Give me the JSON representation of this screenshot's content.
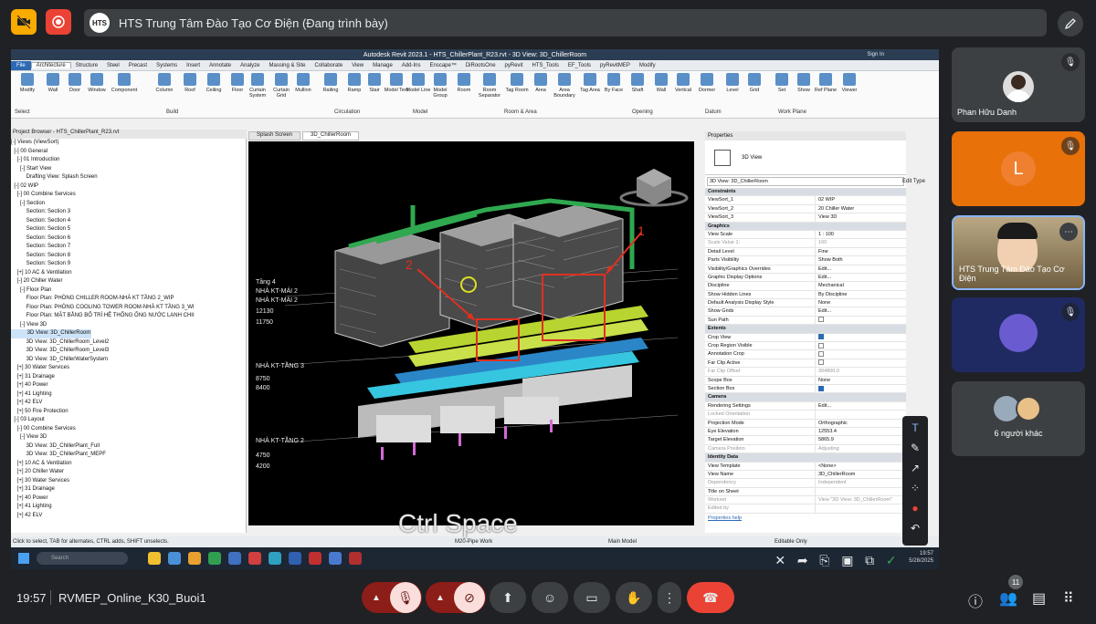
{
  "meet": {
    "presenter_title": "HTS Trung Tâm Đào Tạo Cơ Điện (Đang trình bày)",
    "presenter_logo": "HTS",
    "time": "19:57",
    "meeting_code": "RVMEP_Online_K30_Buoi1",
    "participant_count_badge": "11",
    "colors": {
      "bg": "#202124",
      "end_call": "#ea4335",
      "accent_yellow": "#f9ab00"
    }
  },
  "participants": [
    {
      "name": "Phan Hữu Danh",
      "muted": true,
      "bg": "#3c4043"
    },
    {
      "name": "L",
      "muted": true,
      "bg": "#e8710a"
    },
    {
      "name": "HTS Trung Tâm Đào Tạo Cơ Điện",
      "muted": false,
      "bg": "#8a7a5a"
    },
    {
      "name": "",
      "muted": true,
      "bg": "#1f2a63"
    },
    {
      "name": "6 người khác",
      "muted": false,
      "bg": "#3c4043"
    }
  ],
  "revit": {
    "window_title": "Autodesk Revit 2023.1 - HTS_ChillerPlant_R23.rvt - 3D View: 3D_ChillerRoom",
    "sign_in": "Sign In",
    "tabs": [
      "File",
      "Architecture",
      "Structure",
      "Steel",
      "Precast",
      "Systems",
      "Insert",
      "Annotate",
      "Analyze",
      "Massing & Site",
      "Collaborate",
      "View",
      "Manage",
      "Add-Ins",
      "Enscape™",
      "DiRootsOne",
      "pyRevit",
      "HTS_Tools",
      "EF_Tools",
      "pyRevitMEP",
      "Modify"
    ],
    "ribbon_buttons": [
      "Modify",
      "Wall",
      "Door",
      "Window",
      "Component",
      "Column",
      "Roof",
      "Ceiling",
      "Floor",
      "Curtain System",
      "Curtain Grid",
      "Mullion",
      "Railing",
      "Ramp",
      "Stair",
      "Model Text",
      "Model Line",
      "Model Group",
      "Room",
      "Room Separator",
      "Tag Room",
      "Area",
      "Area Boundary",
      "Tag Area",
      "By Face",
      "Shaft",
      "Wall",
      "Vertical",
      "Dormer",
      "Level",
      "Grid",
      "Set",
      "Show",
      "Ref Plane",
      "Viewer"
    ],
    "ribbon_groups": [
      "Select",
      "Build",
      "Circulation",
      "Model",
      "Room & Area",
      "Opening",
      "Datum",
      "Work Plane"
    ],
    "project_browser_title": "Project Browser - HTS_ChillerPlant_R23.rvt",
    "project_browser": [
      "[-] Views (ViewSort)",
      "  [-] 00 General",
      "    [-] 01 Introduction",
      "      [-] Start View",
      "          Drafting View: Splash Screen",
      "  [-] 02 WIP",
      "    [-] 00 Combine Services",
      "      [-] Section",
      "          Section: Section 3",
      "          Section: Section 4",
      "          Section: Section 5",
      "          Section: Section 6",
      "          Section: Section 7",
      "          Section: Section 8",
      "          Section: Section 9",
      "    [+] 10 AC & Ventilation",
      "    [-] 20 Chiller Water",
      "      [-] Floor Plan",
      "          Floor Plan: PHÒNG CHILLER ROOM-NHÀ KT TẦNG 2_WIP",
      "          Floor Plan: PHÒNG COOLING TOWER ROOM-NHÀ KT TẦNG 3_WI",
      "          Floor Plan: MẶT BẰNG BỐ TRÍ HỆ THỐNG ỐNG NƯỚC LẠNH CHII",
      "      [-] View 3D",
      "          3D View: 3D_ChillerRoom",
      "          3D View: 3D_ChillerRoom_Level2",
      "          3D View: 3D_ChillerRoom_Level3",
      "          3D View: 3D_ChillerWaterSystem",
      "    [+] 30 Water Services",
      "    [+] 31 Drainage",
      "    [+] 40 Power",
      "    [+] 41 Lighting",
      "    [+] 42 ELV",
      "    [+] 50 Fire Protection",
      "  [-] 03 Layout",
      "    [-] 00 Combine Services",
      "      [-] View 3D",
      "          3D View: 3D_ChillerPlant_Full",
      "          3D View: 3D_ChillerPlant_MEPF",
      "    [+] 10 AC & Ventilation",
      "    [+] 20 Chiller Water",
      "    [+] 30 Water Services",
      "    [+] 31 Drainage",
      "    [+] 40 Power",
      "    [+] 41 Lighting",
      "    [+] 42 ELV"
    ],
    "selected_view": "3D View: 3D_ChillerRoom",
    "view_tabs": [
      "Splash Screen",
      "3D_ChillerRoom"
    ],
    "levels": [
      "Tầng 4",
      "NHÀ KT-MÁI 2",
      "NHÀ KT-MÁI 2",
      "12130",
      "11750",
      "NHÀ KT-TẦNG 3",
      "8750",
      "8400",
      "NHÀ KT-TẦNG 2",
      "4750",
      "4200"
    ],
    "markers": [
      "1",
      "2"
    ],
    "properties": {
      "title": "Properties",
      "type_name": "3D View",
      "selector": "3D View: 3D_ChillerRoom",
      "edit_type": "Edit Type",
      "rows": [
        {
          "k": "Constraints",
          "section": true
        },
        {
          "k": "ViewSort_1",
          "v": "02 WIP"
        },
        {
          "k": "ViewSort_2",
          "v": "20 Chiller Water"
        },
        {
          "k": "ViewSort_3",
          "v": "View 3D"
        },
        {
          "k": "Graphics",
          "section": true
        },
        {
          "k": "View Scale",
          "v": "1 : 100"
        },
        {
          "k": "Scale Value    1:",
          "v": "100",
          "dim": true
        },
        {
          "k": "Detail Level",
          "v": "Fine"
        },
        {
          "k": "Parts Visibility",
          "v": "Show Both"
        },
        {
          "k": "Visibility/Graphics Overrides",
          "v": "Edit..."
        },
        {
          "k": "Graphic Display Options",
          "v": "Edit..."
        },
        {
          "k": "Discipline",
          "v": "Mechanical"
        },
        {
          "k": "Show Hidden Lines",
          "v": "By Discipline"
        },
        {
          "k": "Default Analysis Display Style",
          "v": "None"
        },
        {
          "k": "Show Grids",
          "v": "Edit..."
        },
        {
          "k": "Sun Path",
          "v": "",
          "check": "off"
        },
        {
          "k": "Extents",
          "section": true
        },
        {
          "k": "Crop View",
          "v": "",
          "check": "on"
        },
        {
          "k": "Crop Region Visible",
          "v": "",
          "check": "off"
        },
        {
          "k": "Annotation Crop",
          "v": "",
          "check": "off"
        },
        {
          "k": "Far Clip Active",
          "v": "",
          "check": "off"
        },
        {
          "k": "Far Clip Offset",
          "v": "304800.0",
          "dim": true
        },
        {
          "k": "Scope Box",
          "v": "None"
        },
        {
          "k": "Section Box",
          "v": "",
          "check": "on"
        },
        {
          "k": "Camera",
          "section": true
        },
        {
          "k": "Rendering Settings",
          "v": "Edit..."
        },
        {
          "k": "Locked Orientation",
          "v": "",
          "dim": true
        },
        {
          "k": "Projection Mode",
          "v": "Orthographic"
        },
        {
          "k": "Eye Elevation",
          "v": "12553.4"
        },
        {
          "k": "Target Elevation",
          "v": "5865.9"
        },
        {
          "k": "Camera Position",
          "v": "Adjusting",
          "dim": true
        },
        {
          "k": "Identity Data",
          "section": true
        },
        {
          "k": "View Template",
          "v": "<None>"
        },
        {
          "k": "View Name",
          "v": "3D_ChillerRoom"
        },
        {
          "k": "Dependency",
          "v": "Independent",
          "dim": true
        },
        {
          "k": "Title on Sheet",
          "v": ""
        },
        {
          "k": "Workset",
          "v": "View \"3D View: 3D_ChillerRoom\"",
          "dim": true
        },
        {
          "k": "Edited by",
          "v": "",
          "dim": true
        }
      ],
      "help_link": "Properties help"
    },
    "status_text": "Click to select, TAB for alternates, CTRL adds, SHIFT unselects.",
    "workset": "M20-Pipe Work",
    "main_model": "Main Model",
    "editable_only": "Editable Only",
    "overlay_text": "Ctrl Space",
    "taskbar_search": "Search",
    "taskbar_time": "19:57",
    "taskbar_date": "5/28/2025"
  },
  "icons": [
    "camera-off-icon",
    "record-icon",
    "pen-icon",
    "mic-off-icon",
    "video-off-icon",
    "present-icon",
    "emoji-icon",
    "captions-icon",
    "raise-hand-icon",
    "more-icon",
    "end-call-icon",
    "info-icon",
    "people-icon",
    "chat-icon",
    "apps-icon"
  ]
}
